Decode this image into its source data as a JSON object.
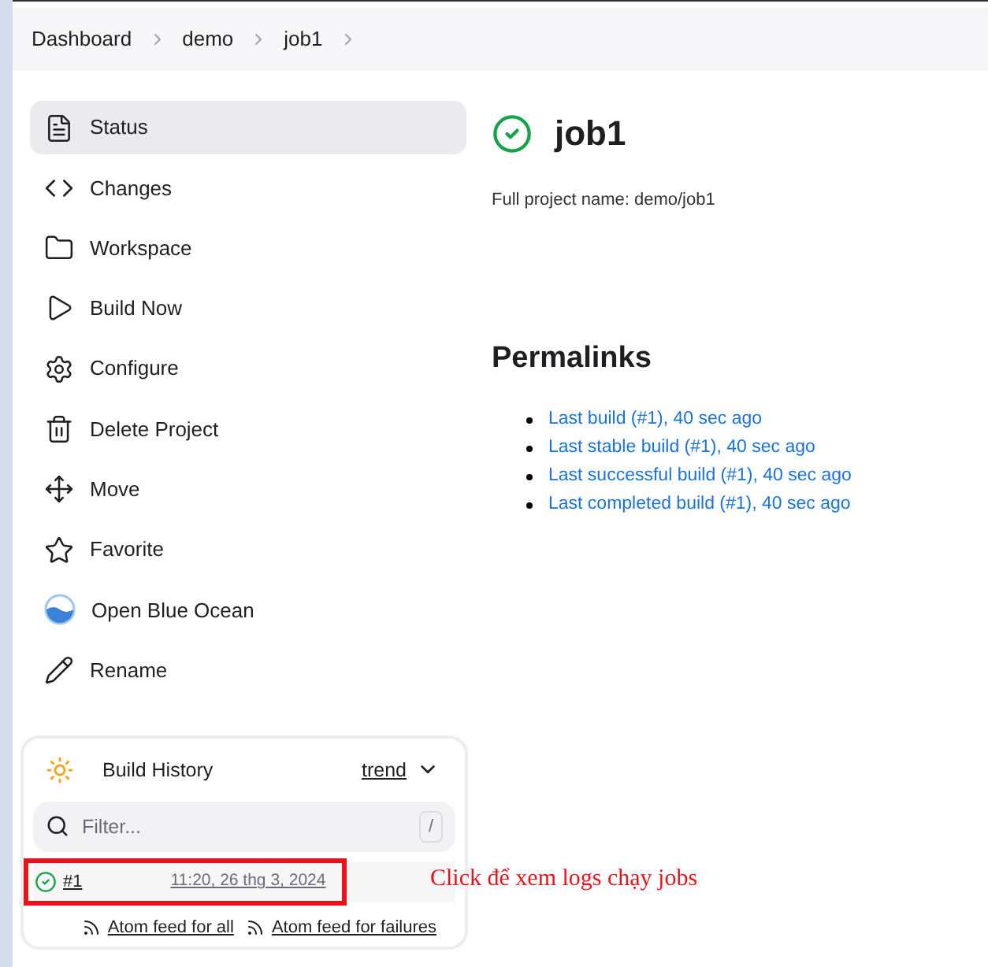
{
  "breadcrumbs": [
    "Dashboard",
    "demo",
    "job1"
  ],
  "sidebar": {
    "items": [
      {
        "label": "Status",
        "selected": true
      },
      {
        "label": "Changes",
        "selected": false
      },
      {
        "label": "Workspace",
        "selected": false
      },
      {
        "label": "Build Now",
        "selected": false
      },
      {
        "label": "Configure",
        "selected": false
      },
      {
        "label": "Delete Project",
        "selected": false
      },
      {
        "label": "Move",
        "selected": false
      },
      {
        "label": "Favorite",
        "selected": false
      },
      {
        "label": "Open Blue Ocean",
        "selected": false
      },
      {
        "label": "Rename",
        "selected": false
      }
    ]
  },
  "build_history": {
    "title": "Build History",
    "trend": "trend",
    "filter": {
      "placeholder": "Filter...",
      "shortcut": "/"
    },
    "builds": [
      {
        "number": "#1",
        "time": "11:20, 26 thg 3, 2024",
        "succeeded": true
      }
    ],
    "feeds": [
      "Atom feed for all",
      "Atom feed for failures"
    ]
  },
  "annotation": {
    "text": "Click để xem logs chạy jobs"
  },
  "job": {
    "title": "job1",
    "succeeded": true,
    "full_name": "Full project name: demo/job1"
  },
  "permalinks": {
    "title": "Permalinks",
    "links": [
      "Last build (#1), 40 sec ago",
      "Last stable build (#1), 40 sec ago",
      "Last successful build (#1), 40 sec ago",
      "Last completed build (#1), 40 sec ago"
    ]
  }
}
